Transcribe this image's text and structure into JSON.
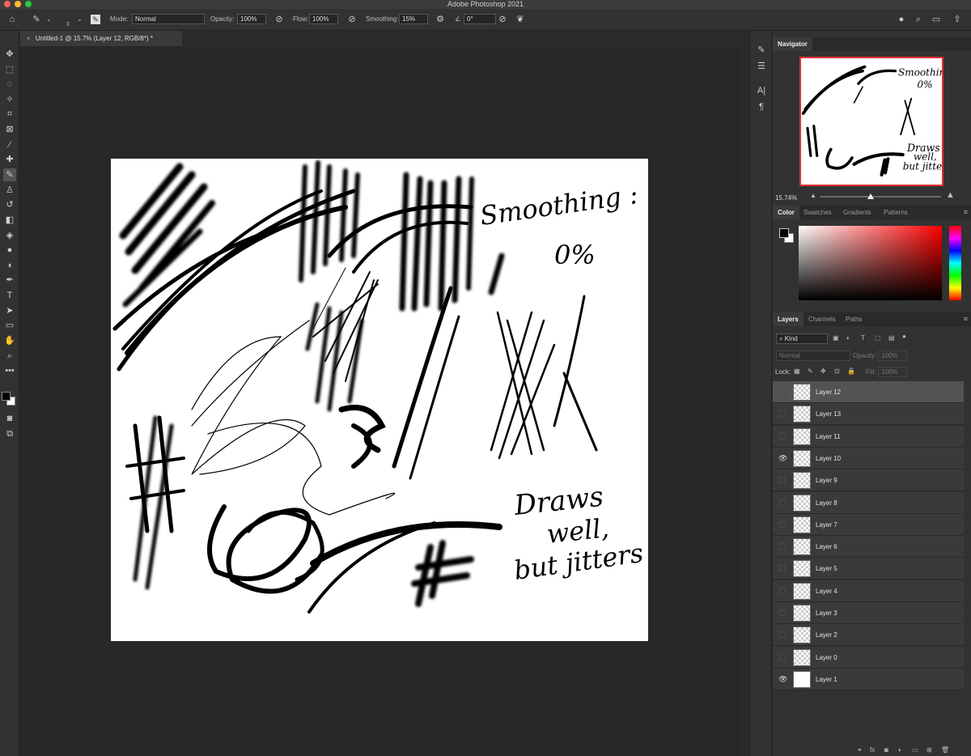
{
  "app": {
    "title": "Adobe Photoshop 2021"
  },
  "options": {
    "brush_size": "3",
    "mode_label": "Mode:",
    "mode_value": "Normal",
    "opacity_label": "Opacity:",
    "opacity_value": "100%",
    "flow_label": "Flow:",
    "flow_value": "100%",
    "smoothing_label": "Smoothing:",
    "smoothing_value": "15%",
    "angle_value": "0°"
  },
  "document": {
    "tab_title": "Untitled-1 @ 15.7% (Layer 12, RGB/8*) *",
    "artboard_text": {
      "line1": "Smoothing :",
      "line2": "0%",
      "line3": "Draws",
      "line4": "well,",
      "line5": "but jitters"
    }
  },
  "navigator": {
    "title": "Navigator",
    "zoom": "15.74%",
    "zoom_level": 0.42,
    "thumb_text": {
      "t1": "Smoothing :",
      "t2": "0%",
      "t3": "Draws",
      "t4": "well,",
      "t5": "but jitters"
    }
  },
  "color_panel": {
    "tabs": [
      "Color",
      "Swatches",
      "Gradients",
      "Patterns"
    ],
    "foreground": "#000000",
    "background": "#ffffff",
    "hue": "#ff0000"
  },
  "layers_panel": {
    "tabs": [
      "Layers",
      "Channels",
      "Paths"
    ],
    "filter_kind": "Kind",
    "blend_mode": "Normal",
    "opacity_label": "Opacity:",
    "opacity_value": "100%",
    "lock_label": "Lock:",
    "fill_label": "Fill:",
    "fill_value": "100%",
    "layers": [
      {
        "name": "Layer 12",
        "visible": false,
        "selected": true
      },
      {
        "name": "Layer 13",
        "visible": false,
        "selected": false
      },
      {
        "name": "Layer 11",
        "visible": false,
        "selected": false
      },
      {
        "name": "Layer 10",
        "visible": true,
        "selected": false
      },
      {
        "name": "Layer 9",
        "visible": false,
        "selected": false
      },
      {
        "name": "Layer 8",
        "visible": false,
        "selected": false
      },
      {
        "name": "Layer 7",
        "visible": false,
        "selected": false
      },
      {
        "name": "Layer 6",
        "visible": false,
        "selected": false
      },
      {
        "name": "Layer 5",
        "visible": false,
        "selected": false
      },
      {
        "name": "Layer 4",
        "visible": false,
        "selected": false
      },
      {
        "name": "Layer 3",
        "visible": false,
        "selected": false
      },
      {
        "name": "Layer 2",
        "visible": false,
        "selected": false
      },
      {
        "name": "Layer 0",
        "visible": false,
        "selected": false
      },
      {
        "name": "Layer 1",
        "visible": true,
        "selected": false
      }
    ]
  }
}
